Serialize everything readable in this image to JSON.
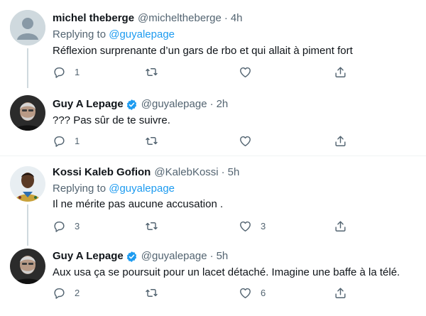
{
  "tweets": [
    {
      "name": "michel theberge",
      "handle": "@micheltheberge",
      "separator": "·",
      "time": "4h",
      "verified": false,
      "replying_prefix": "Replying to ",
      "replying_to": "@guyalepage",
      "text": "Réflexion surprenante d’un gars de rbo et qui allait à piment fort",
      "replies": "1",
      "retweets": "",
      "likes": "",
      "avatar": "default-avatar-icon"
    },
    {
      "name": "Guy A Lepage",
      "handle": "@guyalepage",
      "separator": "·",
      "time": "2h",
      "verified": true,
      "text": "??? Pas sûr de te suivre.",
      "replies": "1",
      "retweets": "",
      "likes": "",
      "avatar": "photo-avatar"
    },
    {
      "name": "Kossi Kaleb Gofion",
      "handle": "@KalebKossi",
      "separator": "·",
      "time": "5h",
      "verified": false,
      "replying_prefix": "Replying to ",
      "replying_to": "@guyalepage",
      "text": "Il ne mérite pas aucune accusation .",
      "replies": "3",
      "retweets": "",
      "likes": "3",
      "avatar": "photo-avatar"
    },
    {
      "name": "Guy A Lepage",
      "handle": "@guyalepage",
      "separator": "·",
      "time": "5h",
      "verified": true,
      "text": "Aux usa ça se poursuit pour un lacet détaché. Imagine une baffe à la télé.",
      "replies": "2",
      "retweets": "",
      "likes": "6",
      "avatar": "photo-avatar"
    }
  ],
  "colors": {
    "accent": "#1d9bf0",
    "text": "#0f1419",
    "secondary": "#536471",
    "line": "#cfd9de",
    "divider": "#eff3f4"
  }
}
